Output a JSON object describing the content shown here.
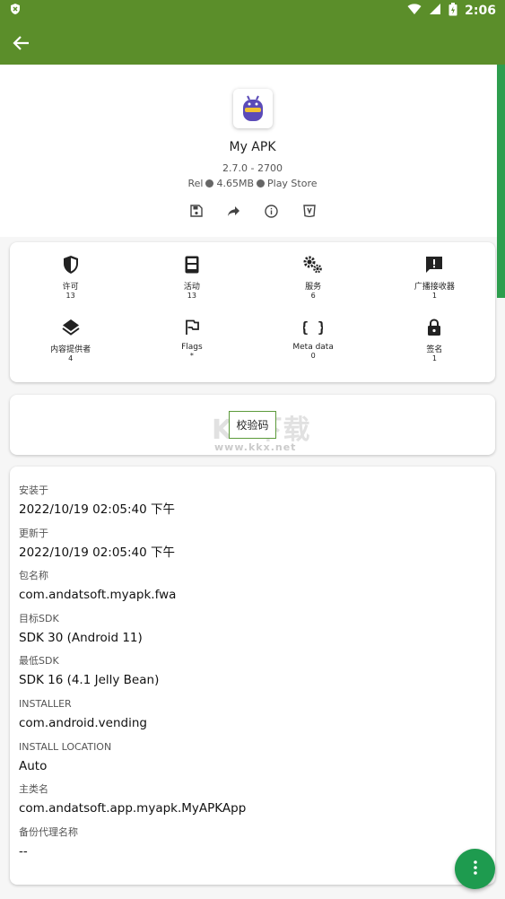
{
  "status_bar": {
    "time": "2:06"
  },
  "app": {
    "name": "My APK",
    "version": "2.7.0 - 2700",
    "release": "Rel",
    "size": "4.65MB",
    "source": "Play Store"
  },
  "components": [
    {
      "label": "许可",
      "count": "13",
      "icon": "shield-icon"
    },
    {
      "label": "活动",
      "count": "13",
      "icon": "activity-icon"
    },
    {
      "label": "服务",
      "count": "6",
      "icon": "gears-icon"
    },
    {
      "label": "广播接收器",
      "count": "1",
      "icon": "alert-message-icon"
    },
    {
      "label": "内容提供者",
      "count": "4",
      "icon": "layers-icon"
    },
    {
      "label": "Flags",
      "count": "*",
      "icon": "flag-icon"
    },
    {
      "label": "Meta data",
      "count": "0",
      "icon": "braces-icon"
    },
    {
      "label": "签名",
      "count": "1",
      "icon": "lock-icon"
    }
  ],
  "checksum": {
    "label": "校验码"
  },
  "watermark": {
    "main": "KK下载",
    "sub": "www.kkx.net"
  },
  "details": [
    {
      "label": "安装于",
      "value": "2022/10/19 02:05:40 下午"
    },
    {
      "label": "更新于",
      "value": "2022/10/19 02:05:40 下午"
    },
    {
      "label": "包名称",
      "value": "com.andatsoft.myapk.fwa"
    },
    {
      "label": "目标SDK",
      "value": "SDK 30 (Android 11)"
    },
    {
      "label": "最低SDK",
      "value": "SDK 16 (4.1 Jelly Bean)"
    },
    {
      "label": "INSTALLER",
      "value": "com.android.vending"
    },
    {
      "label": "INSTALL LOCATION",
      "value": "Auto"
    },
    {
      "label": "主类名",
      "value": "com.andatsoft.app.myapk.MyAPKApp"
    },
    {
      "label": "备份代理名称",
      "value": "--"
    }
  ],
  "colors": {
    "toolbar": "#5b8e2a",
    "fab": "#1e9b4f",
    "scroll_indicator": "#2e9e4e"
  }
}
